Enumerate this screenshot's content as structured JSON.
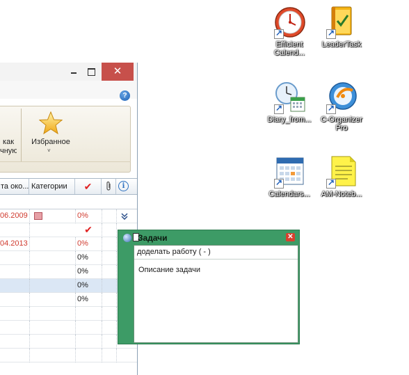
{
  "window": {
    "close_glyph": "✕",
    "help_glyph": "?",
    "ribbon": {
      "truncated_label_1": "как",
      "truncated_label_2": "чную",
      "favorites_label": "Избранное",
      "favorites_dropdown_glyph": "˅",
      "favorites_icon": "star-icon"
    },
    "grid": {
      "headers": {
        "date": "та око...",
        "categories": "Категории",
        "checkmark": "✔",
        "attachment": "📎",
        "info": "i"
      },
      "rows": [
        {
          "date": "06.2009",
          "category_color": "#e6a0a6",
          "progress": "0%",
          "progress_red": true,
          "icon": "»"
        },
        {
          "date": "",
          "checked": "✔"
        },
        {
          "date": "04.2013",
          "progress": "0%",
          "progress_red": true
        },
        {
          "date": "",
          "progress": "0%"
        },
        {
          "date": "",
          "progress": "0%"
        },
        {
          "date": "",
          "progress": "0%",
          "selected": true
        },
        {
          "date": "",
          "progress": "0%"
        }
      ]
    }
  },
  "desktop_icons": [
    {
      "name": "efficient-calendar-icon",
      "label_1": "Efficient",
      "label_2": "Calend..."
    },
    {
      "name": "leadertask-icon",
      "label_1": "LeaderTask",
      "label_2": ""
    },
    {
      "name": "diary-icon",
      "label_1": "Diary_from...",
      "label_2": ""
    },
    {
      "name": "c-organizer-icon",
      "label_1": "C-Organizer",
      "label_2": "Pro"
    },
    {
      "name": "calendars-icon",
      "label_1": "Calendars...",
      "label_2": ""
    },
    {
      "name": "am-notebook-icon",
      "label_1": "AM-Noteb...",
      "label_2": ""
    }
  ],
  "task_note": {
    "title": "Задачи",
    "close_glyph": "✕",
    "subject": "доделать работу ( - )",
    "description": "Описание задачи",
    "background_color": "#3d9b66"
  }
}
